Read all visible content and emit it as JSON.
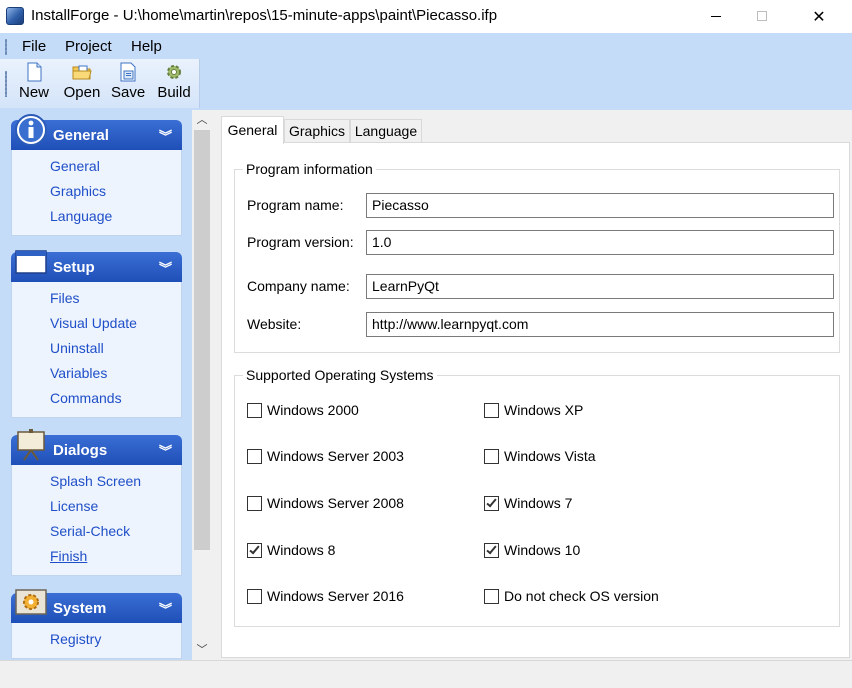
{
  "window": {
    "title": "InstallForge - U:\\home\\martin\\repos\\15-minute-apps\\paint\\Piecasso.ifp",
    "controls": {
      "minimize": "—",
      "maximize": "☐",
      "close": "✕"
    }
  },
  "menu": {
    "items": [
      "File",
      "Project",
      "Help"
    ]
  },
  "toolbar": {
    "buttons": [
      {
        "label": "New",
        "icon": "new-document-icon"
      },
      {
        "label": "Open",
        "icon": "open-folder-icon"
      },
      {
        "label": "Save",
        "icon": "save-icon"
      },
      {
        "label": "Build",
        "icon": "build-gear-icon"
      }
    ]
  },
  "sidebar": {
    "groups": [
      {
        "title": "General",
        "icon": "info-icon",
        "chevron": "»",
        "items": [
          "General",
          "Graphics",
          "Language"
        ]
      },
      {
        "title": "Setup",
        "icon": "window-icon",
        "chevron": "»",
        "items": [
          "Files",
          "Visual Update",
          "Uninstall",
          "Variables",
          "Commands"
        ]
      },
      {
        "title": "Dialogs",
        "icon": "presentation-board-icon",
        "chevron": "»",
        "items": [
          "Splash Screen",
          "License",
          "Serial-Check",
          "Finish"
        ]
      },
      {
        "title": "System",
        "icon": "system-gear-icon",
        "chevron": "»",
        "items": [
          "Registry"
        ]
      }
    ],
    "hovered_item": "Finish"
  },
  "tabs": {
    "items": [
      "General",
      "Graphics",
      "Language"
    ],
    "active": "General"
  },
  "program_info": {
    "legend": "Program information",
    "fields": {
      "program_name": {
        "label": "Program name:",
        "value": "Piecasso"
      },
      "program_version": {
        "label": "Program version:",
        "value": "1.0"
      },
      "company_name": {
        "label": "Company name:",
        "value": "LearnPyQt"
      },
      "website": {
        "label": "Website:",
        "value": "http://www.learnpyqt.com"
      }
    }
  },
  "supported_os": {
    "legend": "Supported Operating Systems",
    "options": [
      {
        "label": "Windows 2000",
        "checked": false
      },
      {
        "label": "Windows XP",
        "checked": false
      },
      {
        "label": "Windows Server 2003",
        "checked": false
      },
      {
        "label": "Windows Vista",
        "checked": false
      },
      {
        "label": "Windows Server 2008",
        "checked": false
      },
      {
        "label": "Windows 7",
        "checked": true
      },
      {
        "label": "Windows 8",
        "checked": true
      },
      {
        "label": "Windows 10",
        "checked": true
      },
      {
        "label": "Windows Server 2016",
        "checked": false
      },
      {
        "label": "Do not check OS version",
        "checked": false
      }
    ]
  },
  "colors": {
    "nav_header": "#2b5fc8",
    "nav_link": "#1f4fc8",
    "band": "#c5dcf9"
  }
}
